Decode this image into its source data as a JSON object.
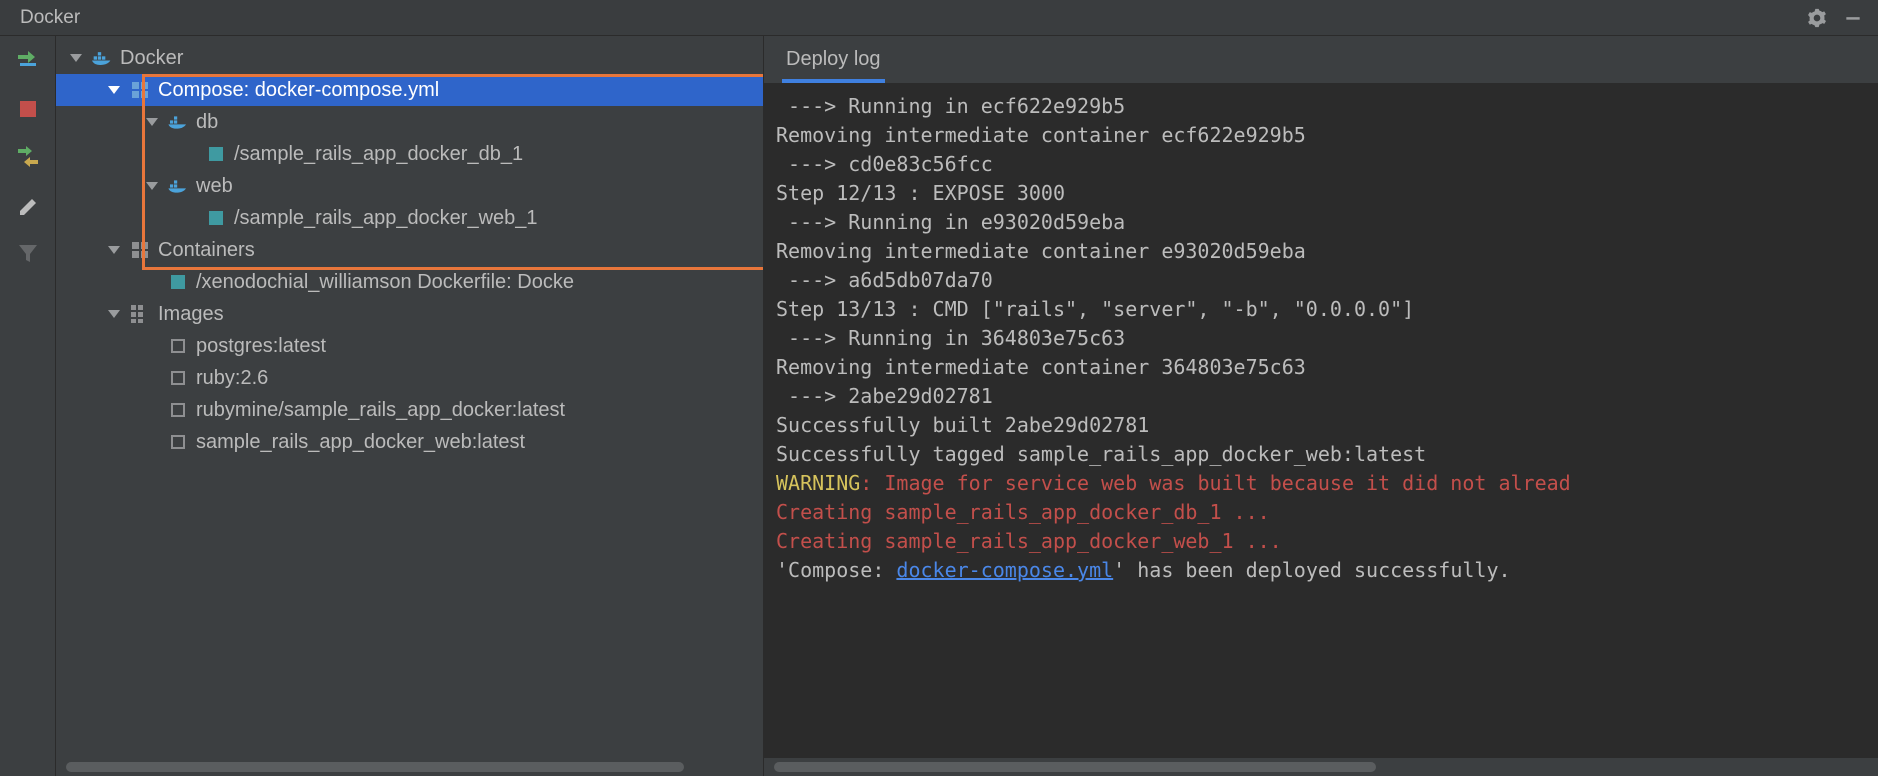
{
  "title": "Docker",
  "tree": {
    "root": "Docker",
    "compose": "Compose: docker-compose.yml",
    "db": "db",
    "db_container": "/sample_rails_app_docker_db_1",
    "web": "web",
    "web_container": "/sample_rails_app_docker_web_1",
    "containers": "Containers",
    "xeno": "/xenodochial_williamson Dockerfile: Docke",
    "images": "Images",
    "image_postgres": "postgres:latest",
    "image_ruby": "ruby:2.6",
    "image_rubymine": "rubymine/sample_rails_app_docker:latest",
    "image_sample_web": "sample_rails_app_docker_web:latest"
  },
  "tab": "Deploy log",
  "log": {
    "l1": " ---> Running in ecf622e929b5",
    "l2": "Removing intermediate container ecf622e929b5",
    "l3": " ---> cd0e83c56fcc",
    "l4": "Step 12/13 : EXPOSE 3000",
    "l5": " ---> Running in e93020d59eba",
    "l6": "Removing intermediate container e93020d59eba",
    "l7": " ---> a6d5db07da70",
    "l8": "Step 13/13 : CMD [\"rails\", \"server\", \"-b\", \"0.0.0.0\"]",
    "l9": " ---> Running in 364803e75c63",
    "l10": "Removing intermediate container 364803e75c63",
    "l11": " ---> 2abe29d02781",
    "l12": "Successfully built 2abe29d02781",
    "l13": "Successfully tagged sample_rails_app_docker_web:latest",
    "warn_label": "WARNING",
    "warn_rest": ": Image for service web was built because it did not alread",
    "l15": "Creating sample_rails_app_docker_db_1 ...",
    "l16": "Creating sample_rails_app_docker_web_1 ...",
    "l17a": "'Compose: ",
    "l17link": "docker-compose.yml",
    "l17b": "' has been deployed successfully."
  }
}
